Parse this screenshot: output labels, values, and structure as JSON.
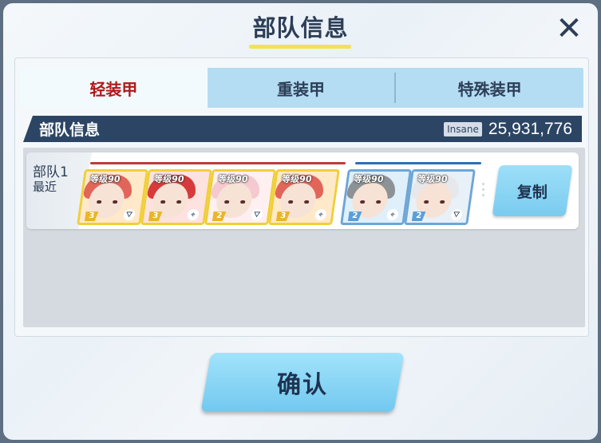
{
  "dialog": {
    "title": "部队信息",
    "close_icon": "close-icon"
  },
  "tabs": [
    {
      "label": "轻装甲",
      "active": true
    },
    {
      "label": "重装甲",
      "active": false
    },
    {
      "label": "特殊装甲",
      "active": false
    }
  ],
  "info_bar": {
    "title": "部队信息",
    "difficulty": "Insane",
    "score": "25,931,776"
  },
  "teams": [
    {
      "name": "部队1",
      "subtitle": "最近",
      "copy_label": "复制",
      "strikers": [
        {
          "level_label": "等级90",
          "stars": "3",
          "role_icon": "support-role-icon",
          "hair": "#e2655a"
        },
        {
          "level_label": "等级90",
          "stars": "3",
          "role_icon": "target-role-icon",
          "hair": "#d63a3a"
        },
        {
          "level_label": "等级90",
          "stars": "2",
          "role_icon": "support-role-icon",
          "hair": "#f4c9cf"
        },
        {
          "level_label": "等级90",
          "stars": "3",
          "role_icon": "target-role-icon",
          "hair": "#e2655a"
        }
      ],
      "specials": [
        {
          "level_label": "等级90",
          "stars": "2",
          "role_icon": "target-role-icon",
          "hair": "#8d9296"
        },
        {
          "level_label": "等级90",
          "stars": "2",
          "role_icon": "support-role-icon",
          "hair": "#e6e8ec"
        }
      ]
    }
  ],
  "confirm_label": "确认",
  "colors": {
    "header_text": "#2c3e57",
    "active_tab_text": "#b01818",
    "info_bar_bg": "#2c4564",
    "button_blue": "#7acbf0",
    "title_underline": "#f2e25a",
    "striker_line": "#c03a3a",
    "special_line": "#2a6fb8"
  }
}
